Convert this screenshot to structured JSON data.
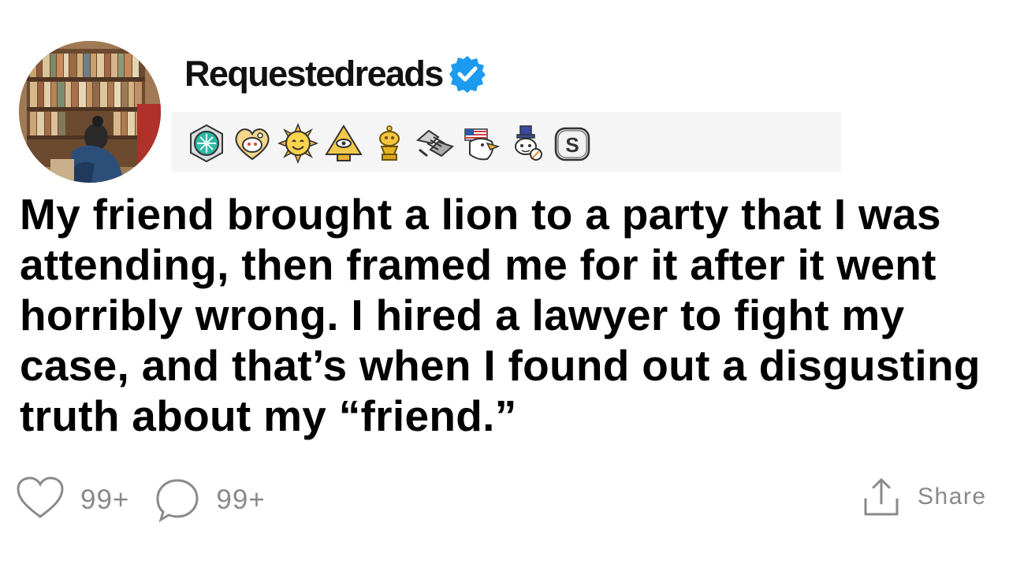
{
  "post": {
    "username": "Requestedreads",
    "verified": true,
    "avatar": "profile-picture-illustration",
    "awards": [
      "teal-gem-award",
      "heart-snoo-award",
      "sun-smile-award",
      "pyramid-eye-award",
      "gold-trophy-snoo-award",
      "handshake-award",
      "eagle-flag-award",
      "snoo-tophat-award",
      "silver-s-award"
    ],
    "title": "My friend brought a lion to a party that I was attending, then framed me for it after it went horribly wrong. I hired a lawyer to fight my case, and that’s when I found out a disgusting truth about my “friend.”",
    "likes": "99+",
    "comments": "99+",
    "share_label": "Share"
  },
  "colors": {
    "verified_blue": "#1d9bf0",
    "muted_text": "#8a8a8a",
    "awards_bar": "#f5f5f5"
  }
}
